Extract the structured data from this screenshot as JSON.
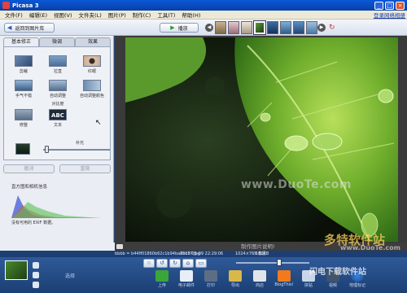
{
  "window": {
    "title": "Picasa 3"
  },
  "menu": {
    "items": [
      "文件(F)",
      "编辑(E)",
      "视图(V)",
      "文件夹(L)",
      "图片(P)",
      "制作(C)",
      "工具(T)",
      "帮助(H)"
    ],
    "signin": "登录网络相册"
  },
  "toolbar": {
    "back_label": "返回到图片库",
    "play_label": "播放"
  },
  "tabs": [
    "基本修正",
    "微调",
    "效果"
  ],
  "tools": [
    {
      "label": "剪裁",
      "icon": "crop-icon"
    },
    {
      "label": "拉直",
      "icon": "straighten-icon"
    },
    {
      "label": "红眼",
      "icon": "redeye-icon"
    },
    {
      "label": "手气不错",
      "icon": "lucky-icon"
    },
    {
      "label": "自动调整",
      "icon": "auto-contrast-icon"
    },
    {
      "label": "自动调整颜色",
      "icon": "auto-color-icon"
    },
    {
      "label": "修整",
      "icon": "retouch-icon"
    },
    {
      "label": "文本",
      "icon": "text-icon",
      "glyph": "ABC"
    }
  ],
  "contrast_label": "对比度",
  "fill_light": {
    "label": "补光",
    "level": 0.0
  },
  "edit_buttons": [
    "撤消",
    "重做"
  ],
  "histogram": {
    "title": "直方图和相机信息",
    "exif_note": "没有可用的 EXIF 数据。"
  },
  "photo": {
    "watermark": "www.DuoTe.com",
    "caption": "制作图片说明!"
  },
  "info": {
    "filename": "bbbb = b44ff01860b62c1b94ba6bc37.jpg",
    "date": "2010-05-09 22:29:06",
    "dimensions": "1024×768 像素",
    "size": "182KB"
  },
  "tray": {
    "status": "选择",
    "actions": [
      "上传",
      "电子邮件",
      "打印",
      "导出",
      "商店",
      "BlogThis!",
      "拼贴",
      "视频",
      "地理标记"
    ]
  },
  "site_watermark": {
    "text": "多特软件站",
    "url": "www.DuoTe.com",
    "bottom_text": "闪电下载软件站"
  }
}
